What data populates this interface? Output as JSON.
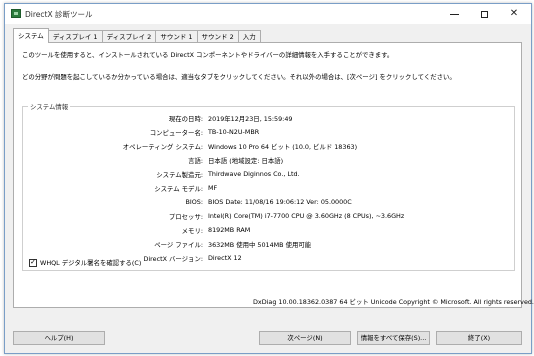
{
  "window": {
    "title": "DirectX 診断ツール"
  },
  "tabs": [
    "システム",
    "ディスプレイ 1",
    "ディスプレイ 2",
    "サウンド 1",
    "サウンド 2",
    "入力"
  ],
  "intro": {
    "line1": "このツールを使用すると、インストールされている DirectX コンポーネントやドライバーの詳細情報を入手することができます。",
    "line2": "どの分野が問題を起こしているか分かっている場合は、適当なタブをクリックしてください。それ以外の場合は、[次ページ] をクリックしてください。"
  },
  "system_info": {
    "title": "システム情報",
    "rows": [
      {
        "label": "現在の日時:",
        "value": "2019年12月23日, 15:59:49"
      },
      {
        "label": "コンピューター名:",
        "value": "TB-10-N2U-MBR"
      },
      {
        "label": "オペレーティング システム:",
        "value": "Windows 10 Pro 64 ビット (10.0, ビルド 18363)"
      },
      {
        "label": "言語:",
        "value": "日本語 (地域設定: 日本語)"
      },
      {
        "label": "システム製造元:",
        "value": "Thirdwave Diginnos Co., Ltd."
      },
      {
        "label": "システム モデル:",
        "value": "MF"
      },
      {
        "label": "BIOS:",
        "value": "BIOS Date: 11/08/16 19:06:12 Ver: 05.0000C"
      },
      {
        "label": "プロセッサ:",
        "value": "Intel(R) Core(TM) i7-7700 CPU @ 3.60GHz (8 CPUs), ~3.6GHz"
      },
      {
        "label": "メモリ:",
        "value": "8192MB RAM"
      },
      {
        "label": "ページ ファイル:",
        "value": "3632MB 使用中 5014MB 使用可能"
      },
      {
        "label": "DirectX バージョン:",
        "value": "DirectX 12"
      }
    ]
  },
  "whql": {
    "label": "WHQL デジタル署名を確認する(C)",
    "checked": "✓"
  },
  "footer": {
    "version": "DxDiag 10.00.18362.0387 64 ビット Unicode  Copyright © Microsoft. All rights reserved."
  },
  "buttons": {
    "help": "ヘルプ(H)",
    "next": "次ページ(N)",
    "save": "情報をすべて保存(S)...",
    "exit": "終了(X)"
  }
}
